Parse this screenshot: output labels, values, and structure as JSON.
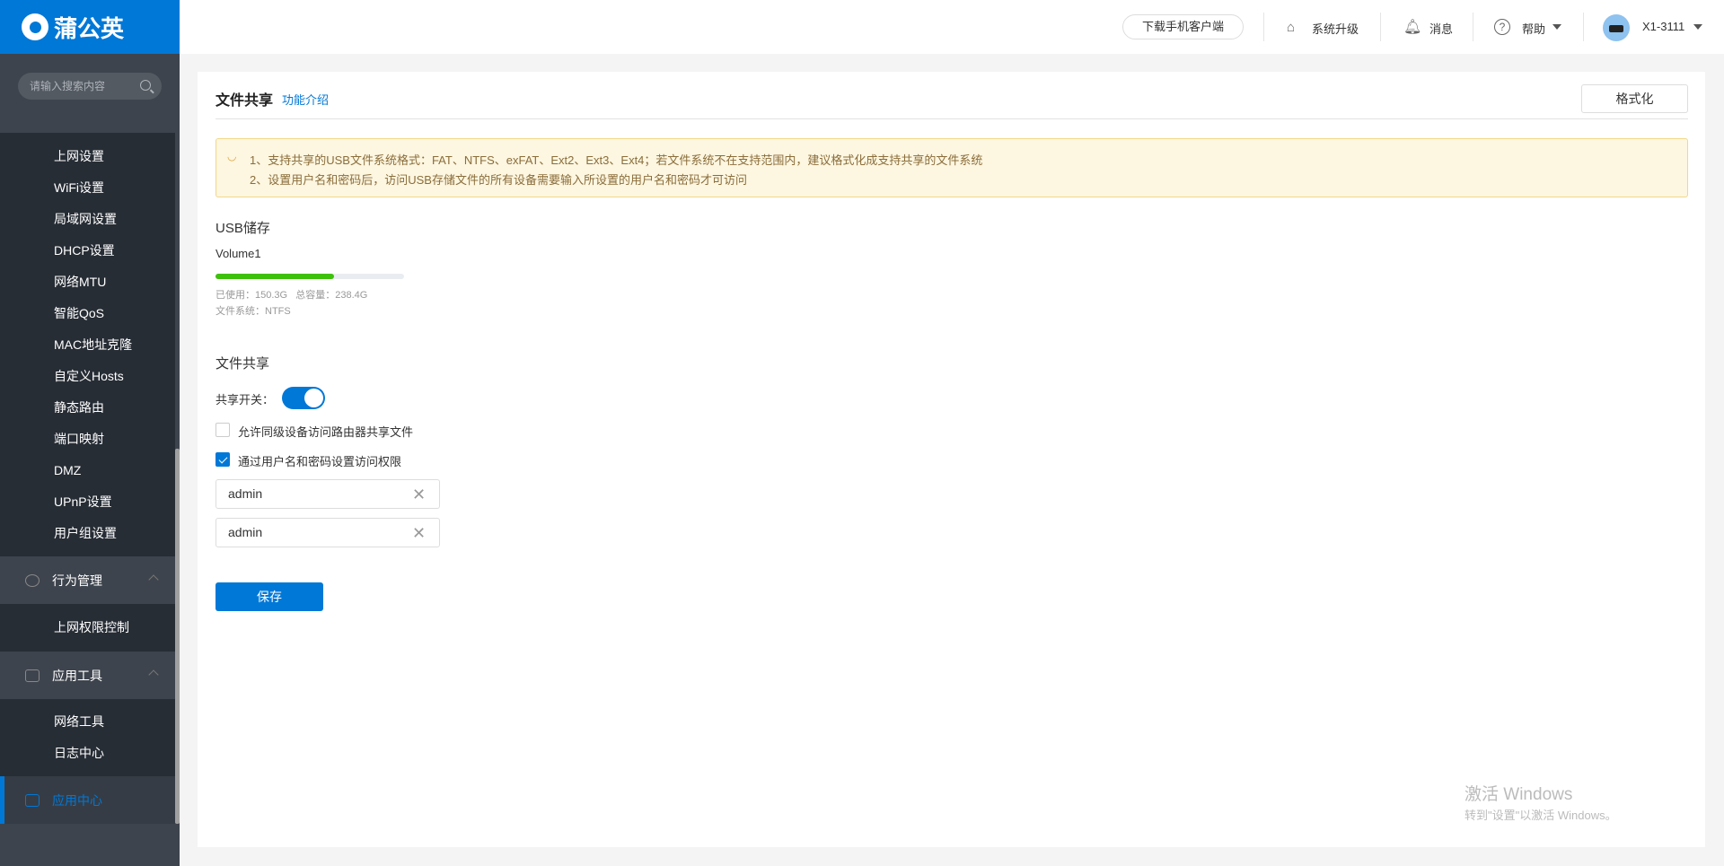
{
  "brand": {
    "name": "蒲公英"
  },
  "header": {
    "download_app": "下载手机客户端",
    "upgrade": "系统升级",
    "messages": "消息",
    "help": "帮助",
    "device": "X1-3111"
  },
  "sidebar": {
    "search_placeholder": "请输入搜索内容",
    "network_items": [
      "上网设置",
      "WiFi设置",
      "局域网设置",
      "DHCP设置",
      "网络MTU",
      "智能QoS",
      "MAC地址克隆",
      "自定义Hosts",
      "静态路由",
      "端口映射",
      "DMZ",
      "UPnP设置",
      "用户组设置"
    ],
    "groups": [
      {
        "label": "行为管理",
        "items": [
          "上网权限控制"
        ]
      },
      {
        "label": "应用工具",
        "items": [
          "网络工具",
          "日志中心"
        ]
      }
    ],
    "active": "应用中心"
  },
  "page": {
    "title": "文件共享",
    "intro_link": "功能介绍",
    "format_button": "格式化",
    "notice": [
      "1、支持共享的USB文件系统格式：FAT、NTFS、exFAT、Ext2、Ext3、Ext4；若文件系统不在支持范围内，建议格式化成支持共享的文件系统",
      "2、设置用户名和密码后，访问USB存储文件的所有设备需要输入所设置的用户名和密码才可访问"
    ],
    "usb": {
      "heading": "USB储存",
      "volume": "Volume1",
      "used_label": "已使用：",
      "used": "150.3G",
      "total_label": "总容量：",
      "total": "238.4G",
      "fs_label": "文件系统：",
      "fs": "NTFS",
      "used_fraction": 0.63
    },
    "share": {
      "heading": "文件共享",
      "switch_label": "共享开关：",
      "switch_on": true,
      "allow_peer": "允许同级设备访问路由器共享文件",
      "allow_peer_checked": false,
      "auth": "通过用户名和密码设置访问权限",
      "auth_checked": true,
      "username": "admin",
      "password": "admin",
      "save": "保存"
    }
  },
  "watermark": {
    "line1": "激活 Windows",
    "line2": "转到\"设置\"以激活 Windows。"
  },
  "colors": {
    "accent": "#0078d7",
    "progress": "#3ec10a"
  }
}
